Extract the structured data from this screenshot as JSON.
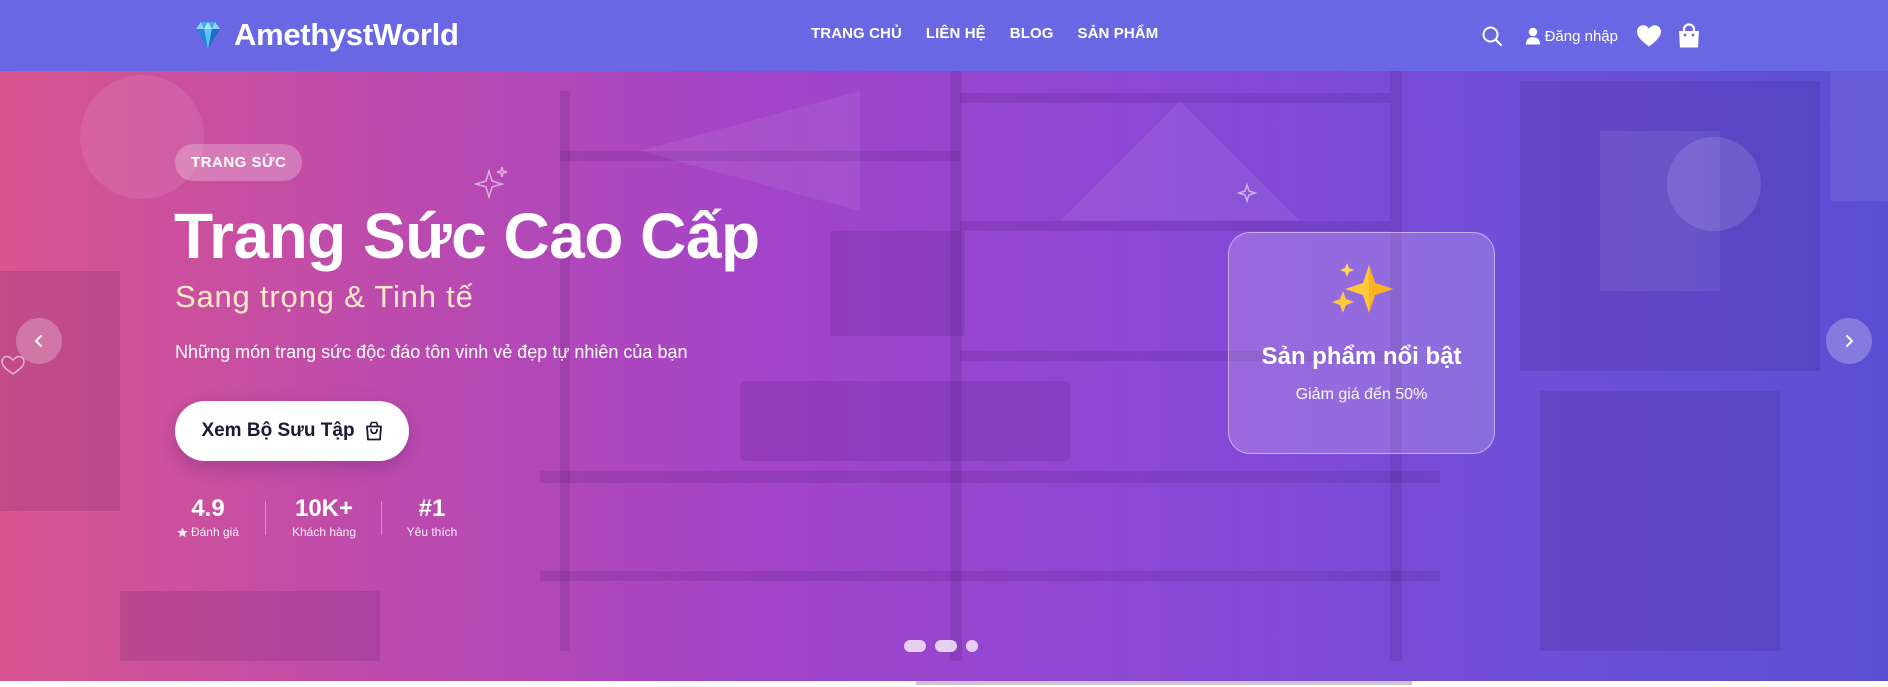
{
  "brand": {
    "name": "AmethystWorld",
    "logo_icon": "gem-icon"
  },
  "nav": {
    "items": [
      {
        "label": "TRANG CHỦ"
      },
      {
        "label": "LIÊN HỆ"
      },
      {
        "label": "BLOG"
      },
      {
        "label": "SẢN PHẨM"
      }
    ]
  },
  "header_actions": {
    "search_icon": "search-icon",
    "login_label": "Đăng nhập",
    "wishlist_icon": "heart-icon",
    "cart_icon": "shopping-bag-icon"
  },
  "hero": {
    "category": "TRANG SỨC",
    "title": "Trang Sức Cao Cấp",
    "subtitle": "Sang trọng & Tinh tế",
    "description": "Những món trang sức độc đáo tôn vinh vẻ đẹp tự nhiên của bạn",
    "cta_label": "Xem Bộ Sưu Tập",
    "stats": [
      {
        "value": "4.9",
        "label": "Đánh giá"
      },
      {
        "value": "10K+",
        "label": "Khách hàng"
      },
      {
        "value": "#1",
        "label": "Yêu thích"
      }
    ],
    "feature_card": {
      "icon": "sparkles-icon",
      "title": "Sản phẩm nổi bật",
      "subtitle": "Giảm giá đến 50%"
    },
    "slides": {
      "count": 3,
      "active_index": 2
    },
    "progress": 0.51
  },
  "colors": {
    "header_bg": "#6a67e5",
    "hero_gradient_start": "#d9558f",
    "hero_gradient_end": "#5a4fd4",
    "subtitle": "#ffe9c7"
  }
}
